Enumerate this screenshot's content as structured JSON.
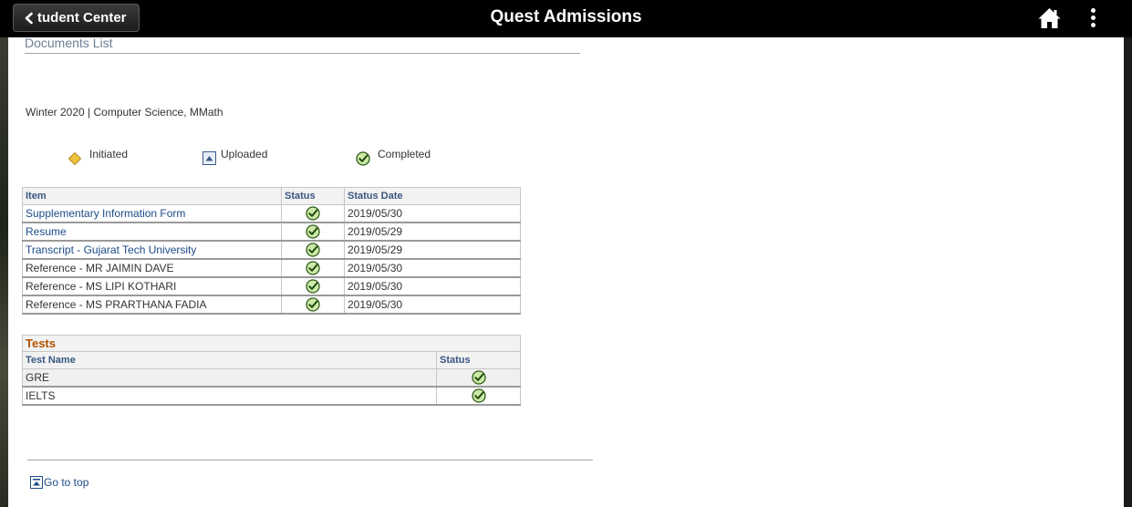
{
  "header": {
    "back_label": "tudent Center",
    "title": "Quest Admissions",
    "home_icon": "home-icon",
    "menu_icon": "kebab-menu-icon"
  },
  "page": {
    "title": "Documents List",
    "term": "Winter 2020 | Computer Science, MMath"
  },
  "legend": {
    "initiated": "Initiated",
    "uploaded": "Uploaded",
    "completed": "Completed",
    "colors": {
      "initiated": "#f0c23b",
      "uploaded": "#3d5a8c",
      "completed": "#6fb12c"
    }
  },
  "documents": {
    "headers": {
      "item": "Item",
      "status": "Status",
      "date": "Status Date"
    },
    "rows": [
      {
        "item": "Supplementary Information Form",
        "status": "completed",
        "date": "2019/05/30",
        "link": true
      },
      {
        "item": "Resume",
        "status": "completed",
        "date": "2019/05/29",
        "link": true
      },
      {
        "item": "Transcript - Gujarat Tech University",
        "status": "completed",
        "date": "2019/05/29",
        "link": true
      },
      {
        "item": "Reference - MR JAIMIN DAVE",
        "status": "completed",
        "date": "2019/05/30",
        "link": false
      },
      {
        "item": "Reference - MS LIPI KOTHARI",
        "status": "completed",
        "date": "2019/05/30",
        "link": false
      },
      {
        "item": "Reference - MS PRARTHANA FADIA",
        "status": "completed",
        "date": "2019/05/30",
        "link": false
      }
    ]
  },
  "tests": {
    "title": "Tests",
    "headers": {
      "name": "Test Name",
      "status": "Status"
    },
    "rows": [
      {
        "name": "GRE",
        "status": "completed"
      },
      {
        "name": "IELTS",
        "status": "completed"
      }
    ]
  },
  "footer": {
    "goto_top": "Go to top"
  }
}
